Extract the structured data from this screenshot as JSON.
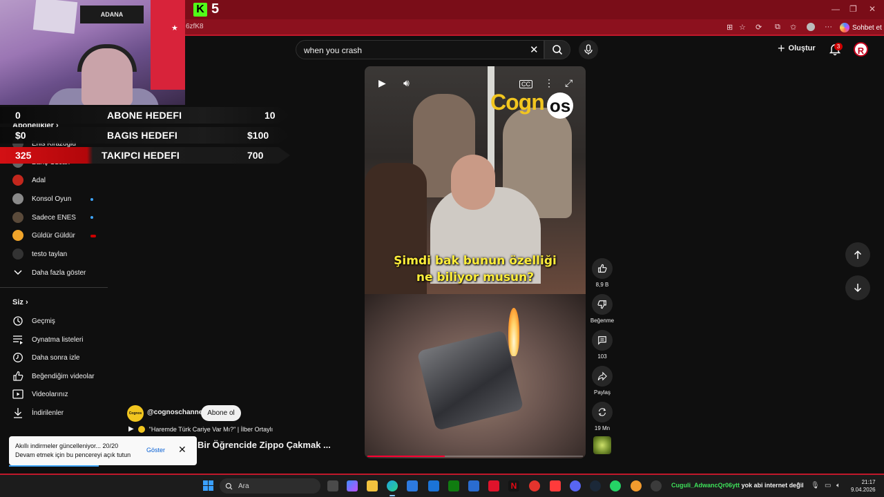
{
  "browser": {
    "kick_count": "5",
    "url_fragment": "6zfK8",
    "copilot_label": "Sohbet et"
  },
  "youtube_header": {
    "search_query": "when you crash",
    "create_label": "Oluştur",
    "notif_count": "3",
    "avatar_letter": "R"
  },
  "stream_overlay": {
    "cam_banner": "ADANA",
    "goals": [
      {
        "left": "0",
        "label": "ABONE HEDEFI",
        "right": "10"
      },
      {
        "left": "$0",
        "label": "BAGIS HEDEFI",
        "right": "$100"
      },
      {
        "left": "325",
        "label": "TAKIPCI HEDEFI",
        "right": "700"
      }
    ]
  },
  "sidebar": {
    "subs_title": "Abonelikler",
    "subscriptions": [
      {
        "label": "Enis Kirazoglu"
      },
      {
        "label": "Barış Özcan"
      },
      {
        "label": "Adal"
      },
      {
        "label": "Konsol Oyun"
      },
      {
        "label": "Sadece ENES"
      },
      {
        "label": "Güldür Güldür"
      },
      {
        "label": "testo taylan"
      }
    ],
    "show_more": "Daha fazla göster",
    "you_title": "Siz",
    "you_items": [
      {
        "label": "Geçmiş",
        "icon": "history-icon"
      },
      {
        "label": "Oynatma listeleri",
        "icon": "playlists-icon"
      },
      {
        "label": "Daha sonra izle",
        "icon": "watch-later-icon"
      },
      {
        "label": "Beğendiğim videolar",
        "icon": "liked-icon"
      },
      {
        "label": "Videolarınız",
        "icon": "your-videos-icon"
      },
      {
        "label": "İndirilenler",
        "icon": "downloads-icon"
      }
    ]
  },
  "player": {
    "watermark": "Cogn",
    "watermark_o": "os",
    "caption_line1": "Şimdi bak bunun özelliği",
    "caption_line2": "ne biliyor musun?",
    "progress": 0.36
  },
  "actions": {
    "likes": "8,9 B",
    "dislike_label": "Beğenme",
    "comments": "103",
    "share_label": "Paylaş",
    "remix_label": "19 Mn"
  },
  "channel": {
    "logo_text": "Cognos",
    "handle": "@cognoschannel",
    "subscribe_label": "Abone ol",
    "playlist_title": "\"Haremde Türk Cariye Var Mı?\" | İlber Ortaylı",
    "short_title": "Bir Öğrencide Zippo Çakmak ..."
  },
  "toast": {
    "line1": "Akıllı indirmeler güncelleniyor... 20/20",
    "line2": "Devam etmek için bu pencereyi açık tutun",
    "action": "Göster"
  },
  "taskbar": {
    "search_placeholder": "Ara",
    "status_green": "Cuguli_AdwancQr06ytt",
    "status_white": "yok abi internet değil",
    "time": "21:17",
    "date": "9.04.2026"
  },
  "colors": {
    "browser_frame": "#7a0d18",
    "youtube_bg": "#0f0f0f",
    "caption_yellow": "#ffee3a",
    "kick_green": "#53fc18"
  }
}
